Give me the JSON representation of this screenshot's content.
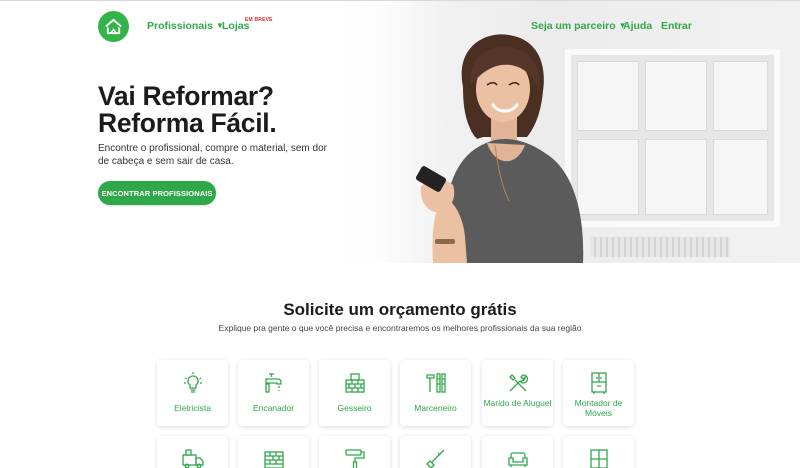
{
  "nav": {
    "items": [
      {
        "label": "Profissionais",
        "has_dropdown": true
      },
      {
        "label": "Lojas",
        "badge": "EM BREVE"
      },
      {
        "label": "Seja um parceiro",
        "has_dropdown": true
      },
      {
        "label": "Ajuda"
      },
      {
        "label": "Entrar"
      }
    ]
  },
  "hero": {
    "title_line1": "Vai Reformar?",
    "title_line2": "Reforma Fácil.",
    "subtitle": "Encontre o profissional, compre o material, sem dor de cabeça e sem sair de casa.",
    "cta_label": "ENCONTRAR PROFISSIONAIS"
  },
  "section": {
    "title": "Solicite um orçamento grátis",
    "subtitle": "Explique pra gente o que você precisa e encontraremos os melhores profissionais da sua região"
  },
  "services": [
    {
      "label": "Eletricista",
      "icon": "light-bulb-icon"
    },
    {
      "label": "Encanador",
      "icon": "faucet-icon"
    },
    {
      "label": "Gesseiro",
      "icon": "bricks-icon"
    },
    {
      "label": "Marceneiro",
      "icon": "woodwork-tools-icon"
    },
    {
      "label": "Marido de Aluguel",
      "icon": "wrench-screwdriver-icon"
    },
    {
      "label": "Montador de Móveis",
      "icon": "cabinet-icon"
    }
  ],
  "services_row2_icons": [
    "moving-truck-icon",
    "wall-icon",
    "paint-roller-icon",
    "garden-tools-icon",
    "sofa-icon",
    "window-icon"
  ],
  "colors": {
    "brand_green": "#2fa84a",
    "badge_red": "#e0282a",
    "text_dark": "#1b1b1b"
  }
}
